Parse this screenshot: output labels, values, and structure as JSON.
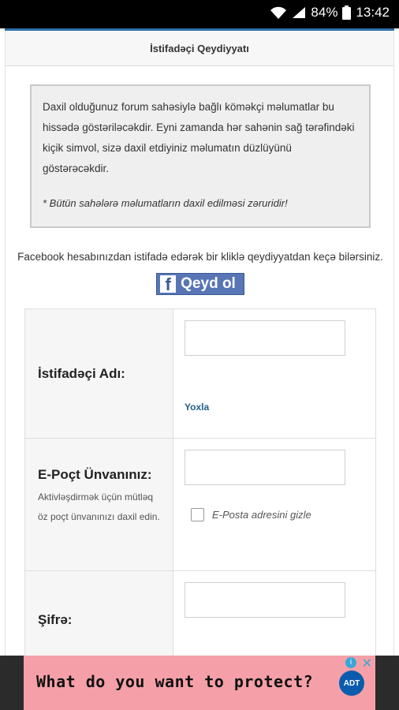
{
  "status_bar": {
    "battery": "84%",
    "time": "13:42"
  },
  "header": {
    "title": "İstifadəçi Qeydiyyatı"
  },
  "info_box": {
    "text": "Daxil olduğunuz forum sahəsiylə bağlı köməkçi məlumatlar bu hissədə göstəriləcəkdir. Eyni zamanda hər sahənin sağ tərəfindəki kiçik simvol, sizə daxil etdiyiniz məlumatın düzlüyünü göstərəcəkdir.",
    "note": "* Bütün sahələrə məlumatların daxil edilməsi zəruridir!"
  },
  "facebook": {
    "text": "Facebook hesabınızdan istifadə edərək bir kliklə qeydiyyatdan keçə bilərsiniz.",
    "button_label": "Qeyd ol",
    "icon": "f"
  },
  "form": {
    "username": {
      "label": "İstifadəçi Adı:",
      "value": "",
      "check_link": "Yoxla"
    },
    "email": {
      "label": "E-Poçt Ünvanınız:",
      "help": "Aktivləşdirmək üçün mütləq öz poçt ünvanınızı daxil edin.",
      "value": "",
      "hide_label": "E-Posta adresini gizle"
    },
    "password": {
      "label": "Şifrə:",
      "value": ""
    }
  },
  "ad": {
    "text": "What do you want to protect?",
    "brand": "ADT",
    "info_glyph": "i",
    "close_glyph": "✕"
  }
}
